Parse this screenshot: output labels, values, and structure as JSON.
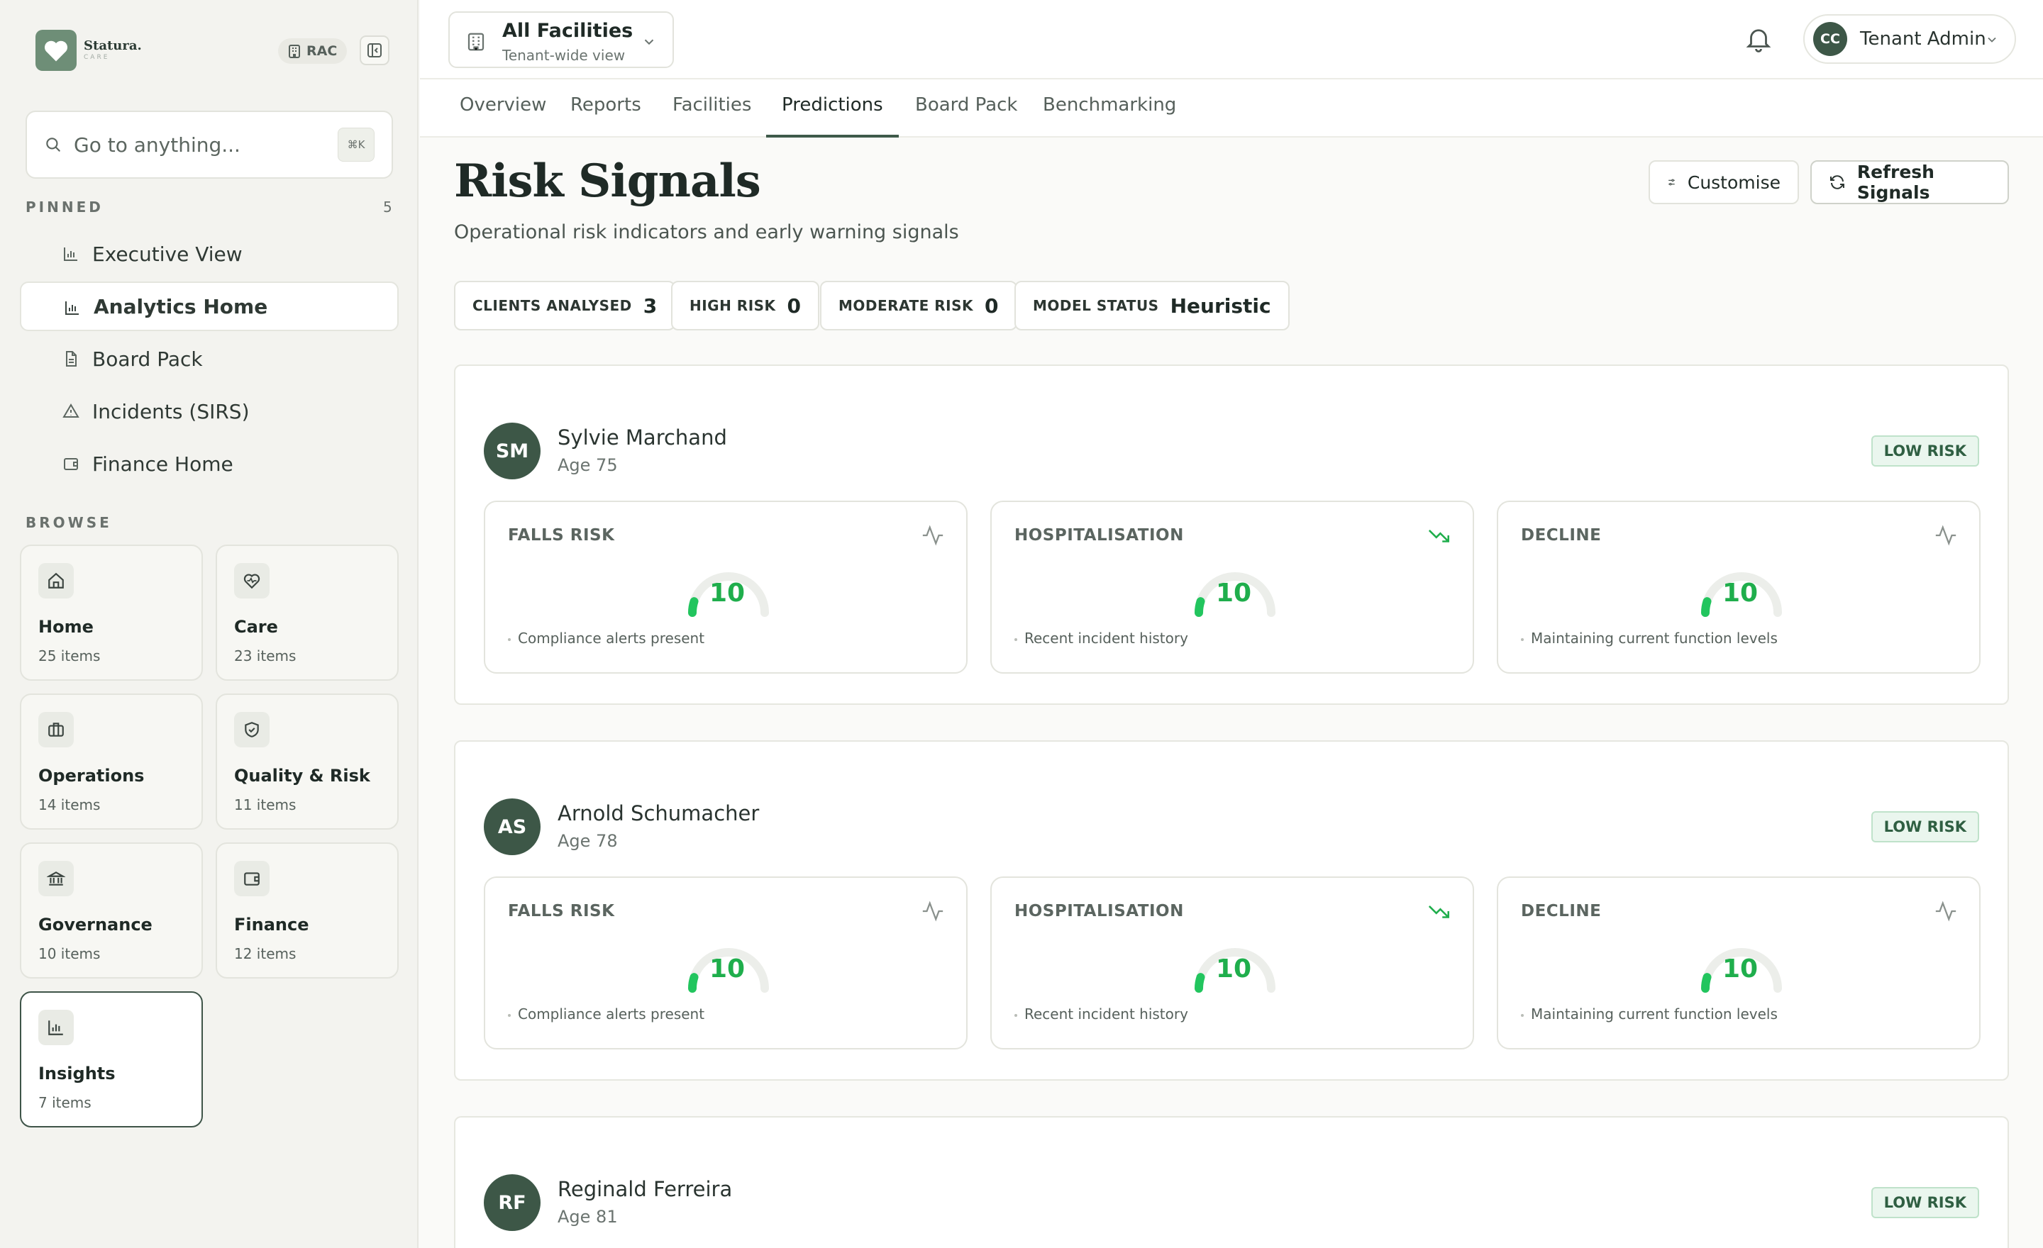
{
  "brand": {
    "name": "Statura.",
    "sub": "CARE",
    "pill": "RAC"
  },
  "search": {
    "placeholder": "Go to anything...",
    "shortcut": "⌘K"
  },
  "pinned": {
    "label": "PINNED",
    "count": "5",
    "items": [
      {
        "label": "Executive View",
        "icon": "bar-chart-icon"
      },
      {
        "label": "Analytics Home",
        "icon": "bar-chart-icon",
        "active": true
      },
      {
        "label": "Board Pack",
        "icon": "document-icon"
      },
      {
        "label": "Incidents (SIRS)",
        "icon": "alert-triangle-icon"
      },
      {
        "label": "Finance Home",
        "icon": "wallet-icon"
      }
    ]
  },
  "browse": {
    "label": "BROWSE",
    "tiles": [
      {
        "title": "Home",
        "count": "25 items",
        "icon": "home-icon"
      },
      {
        "title": "Care",
        "count": "23 items",
        "icon": "heart-pulse-icon"
      },
      {
        "title": "Operations",
        "count": "14 items",
        "icon": "briefcase-icon"
      },
      {
        "title": "Quality & Risk",
        "count": "11 items",
        "icon": "shield-check-icon"
      },
      {
        "title": "Governance",
        "count": "10 items",
        "icon": "landmark-icon"
      },
      {
        "title": "Finance",
        "count": "12 items",
        "icon": "wallet-icon"
      },
      {
        "title": "Insights",
        "count": "7 items",
        "icon": "bar-chart-icon",
        "active": true
      }
    ]
  },
  "header": {
    "facility_title": "All Facilities",
    "facility_sub": "Tenant-wide view",
    "user_initials": "CC",
    "user_name": "Tenant Admin"
  },
  "tabs": [
    {
      "label": "Overview"
    },
    {
      "label": "Reports"
    },
    {
      "label": "Facilities"
    },
    {
      "label": "Predictions",
      "active": true
    },
    {
      "label": "Board Pack"
    },
    {
      "label": "Benchmarking"
    }
  ],
  "page": {
    "title": "Risk Signals",
    "subtitle": "Operational risk indicators and early warning signals",
    "customise_label": "Customise",
    "refresh_label": "Refresh Signals"
  },
  "stats": [
    {
      "label": "CLIENTS ANALYSED",
      "value": "3"
    },
    {
      "label": "HIGH RISK",
      "value": "0"
    },
    {
      "label": "MODERATE RISK",
      "value": "0"
    },
    {
      "label": "MODEL STATUS",
      "value": "Heuristic"
    }
  ],
  "colors": {
    "accent": "#3d5747",
    "gauge_green": "#22c55e",
    "badge_bg": "#eaf6ee"
  },
  "clients": [
    {
      "initials": "SM",
      "name": "Sylvie Marchand",
      "age": "Age 75",
      "risk": "LOW RISK",
      "metrics": [
        {
          "title": "FALLS RISK",
          "value": "10",
          "level": 0.1,
          "note": "Compliance alerts present",
          "icon": "activity-icon"
        },
        {
          "title": "HOSPITALISATION",
          "value": "10",
          "level": 0.1,
          "note": "Recent incident history",
          "icon": "trending-down-icon"
        },
        {
          "title": "DECLINE",
          "value": "10",
          "level": 0.1,
          "note": "Maintaining current function levels",
          "icon": "activity-icon"
        }
      ]
    },
    {
      "initials": "AS",
      "name": "Arnold Schumacher",
      "age": "Age 78",
      "risk": "LOW RISK",
      "metrics": [
        {
          "title": "FALLS RISK",
          "value": "10",
          "level": 0.1,
          "note": "Compliance alerts present",
          "icon": "activity-icon"
        },
        {
          "title": "HOSPITALISATION",
          "value": "10",
          "level": 0.1,
          "note": "Recent incident history",
          "icon": "trending-down-icon"
        },
        {
          "title": "DECLINE",
          "value": "10",
          "level": 0.1,
          "note": "Maintaining current function levels",
          "icon": "activity-icon"
        }
      ]
    },
    {
      "initials": "RF",
      "name": "Reginald Ferreira",
      "age": "Age 81",
      "risk": "LOW RISK",
      "metrics": []
    }
  ]
}
